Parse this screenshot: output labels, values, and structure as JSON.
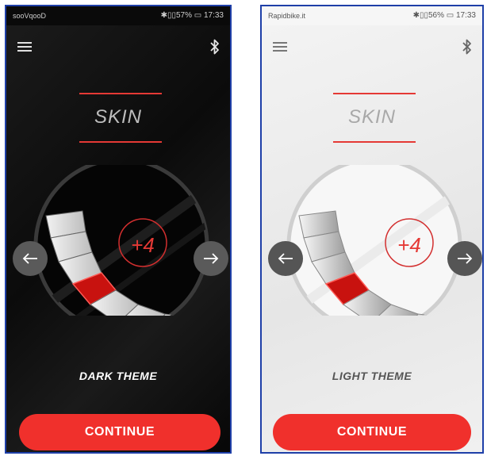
{
  "dark": {
    "status_left": "sooVqooD",
    "status_right": "✱▯▯57% ▭ 17:33",
    "title": "SKIN",
    "gauge_value": "+4",
    "theme_label": "DARK THEME",
    "continue_label": "CONTINUE"
  },
  "light": {
    "status_left": "Rapidbike.it",
    "status_right": "✱▯▯56% ▭ 17:33",
    "title": "SKIN",
    "gauge_value": "+4",
    "theme_label": "LIGHT THEME",
    "continue_label": "CONTINUE"
  },
  "colors": {
    "accent": "#e53935",
    "button": "#f0302c",
    "dark_bg": "#0b0b0b",
    "light_bg": "#ececec"
  }
}
